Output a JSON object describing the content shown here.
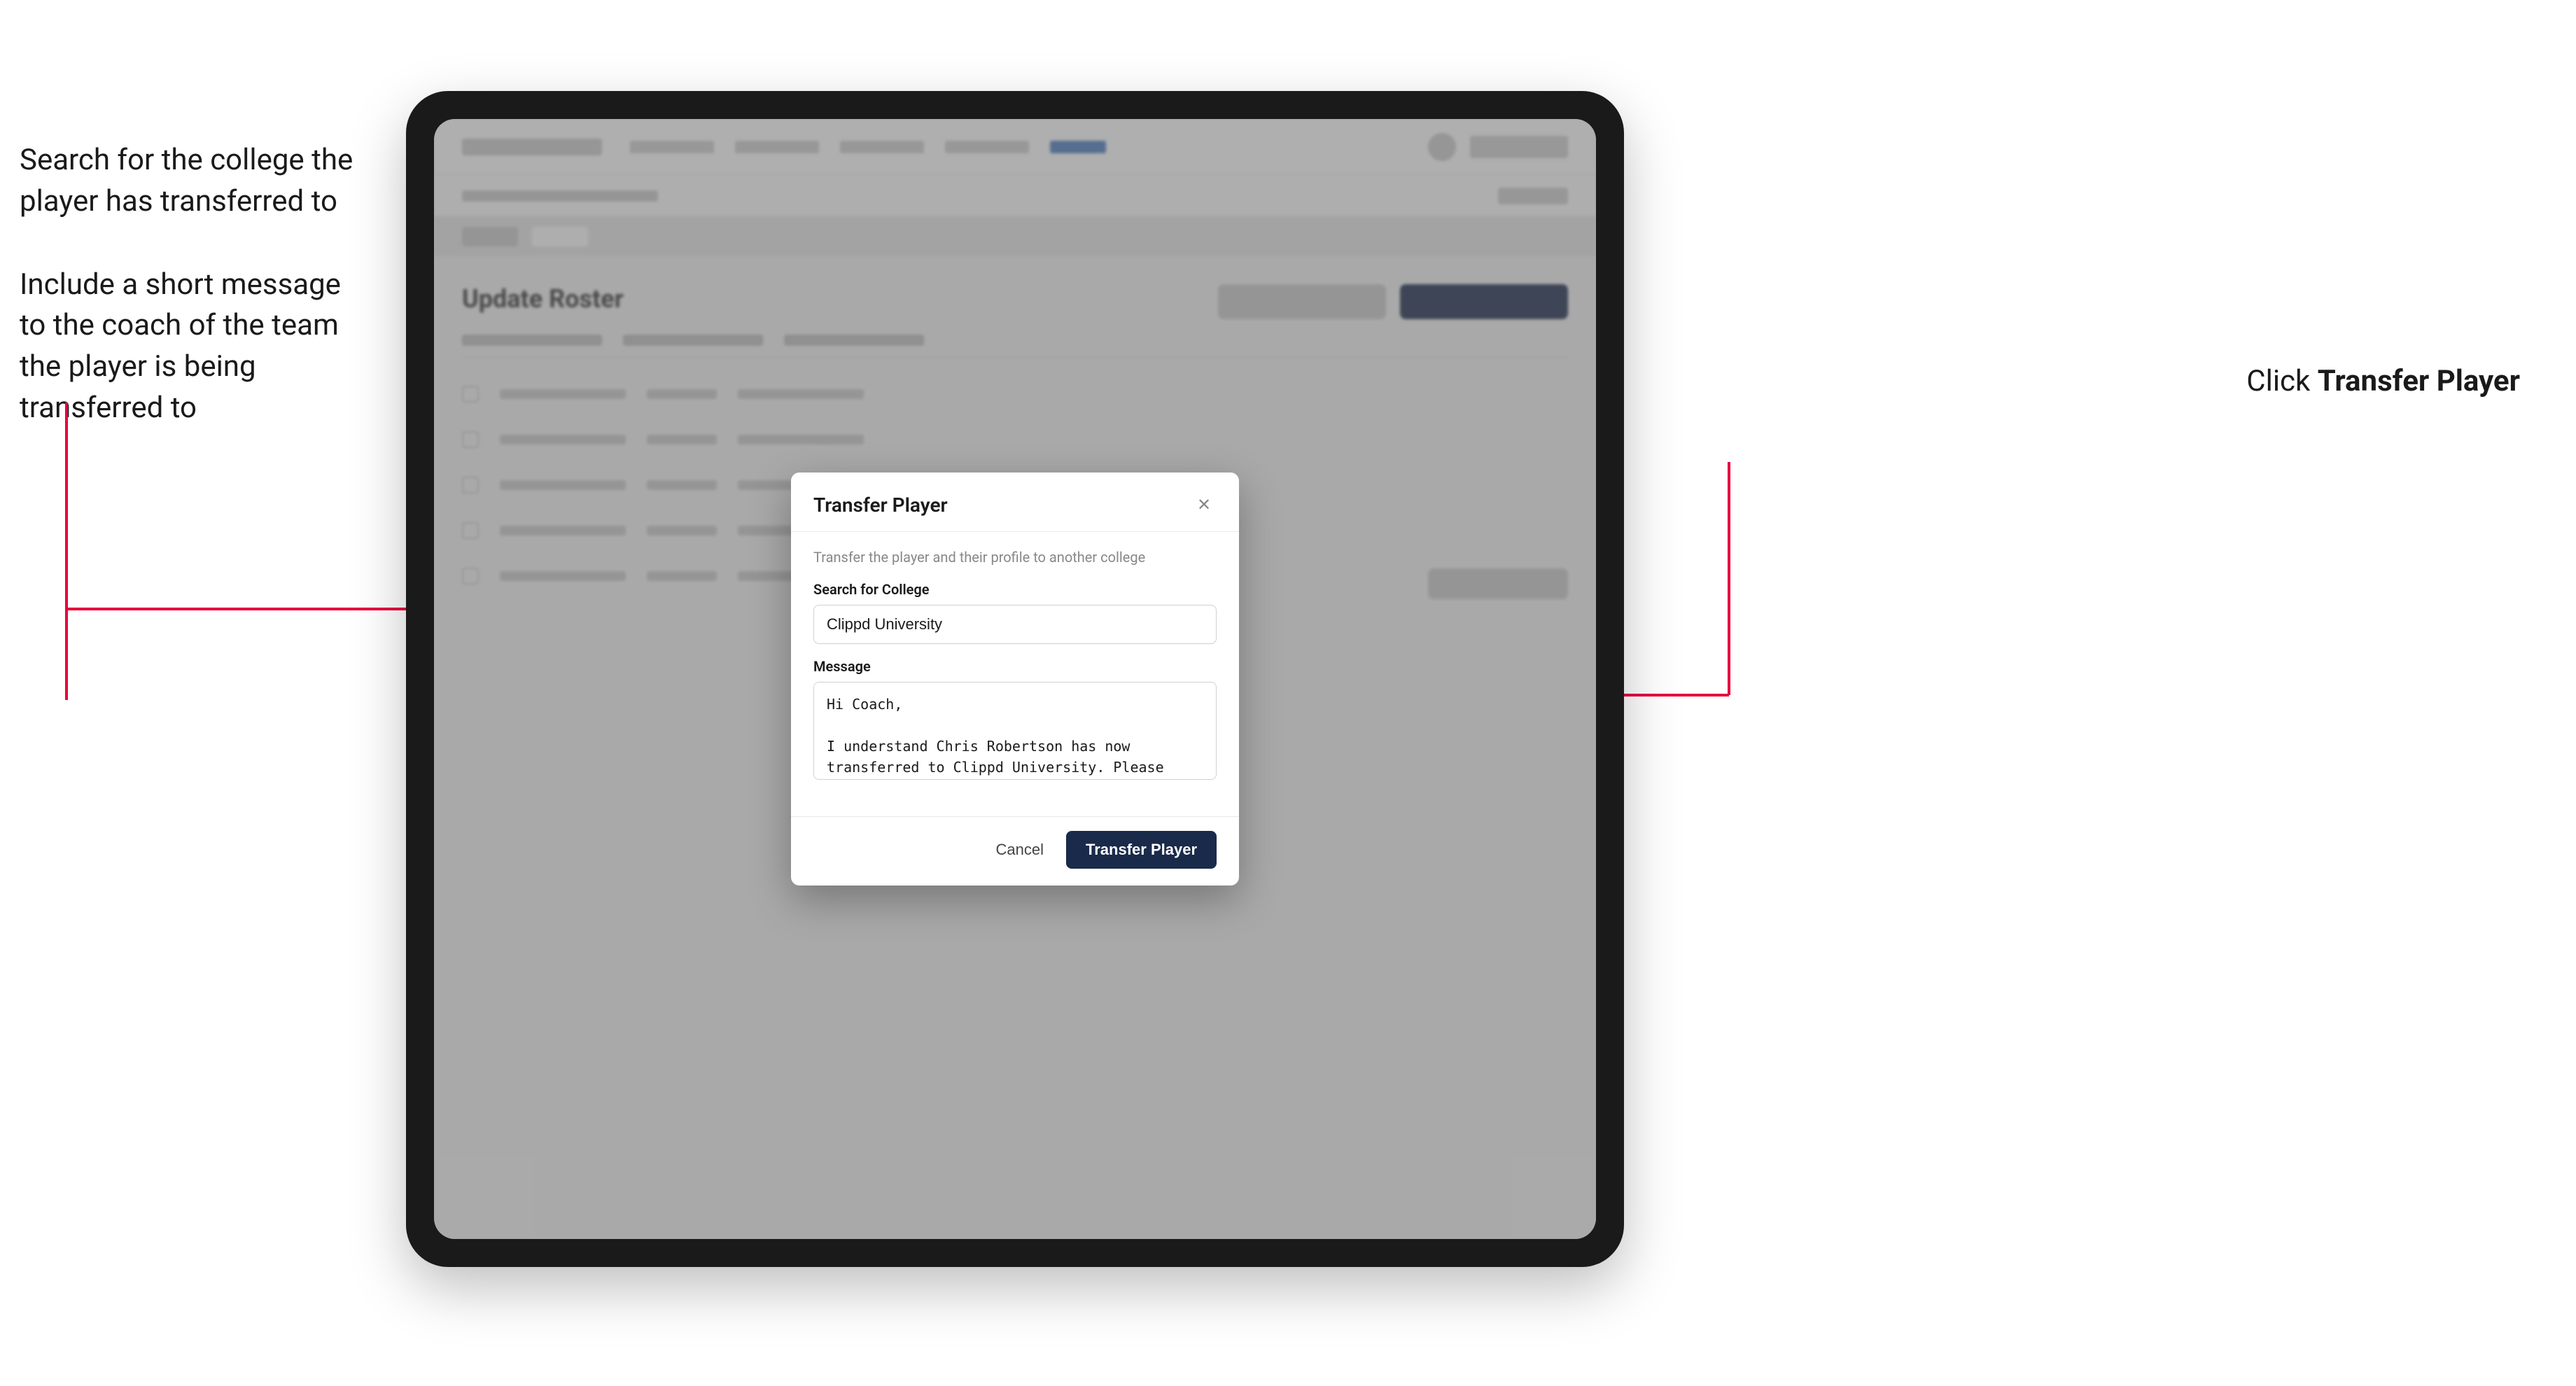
{
  "annotations": {
    "left_top": "Search for the college the player has transferred to",
    "left_bottom": "Include a short message\nto the coach of the team\nthe player is being\ntransferred to",
    "right": "Click ",
    "right_bold": "Transfer Player"
  },
  "modal": {
    "title": "Transfer Player",
    "description": "Transfer the player and their profile to another college",
    "search_label": "Search for College",
    "search_value": "Clippd University",
    "message_label": "Message",
    "message_value": "Hi Coach,\n\nI understand Chris Robertson has now transferred to Clippd University. Please accept this transfer request when you can.",
    "cancel_label": "Cancel",
    "transfer_label": "Transfer Player"
  },
  "app": {
    "roster_title": "Update Roster"
  }
}
